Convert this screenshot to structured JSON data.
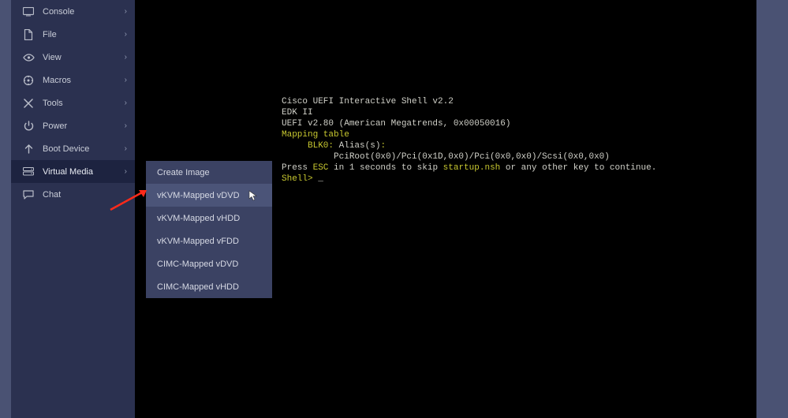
{
  "sidebar": {
    "items": [
      {
        "label": "Console",
        "icon": "console-icon"
      },
      {
        "label": "File",
        "icon": "file-icon"
      },
      {
        "label": "View",
        "icon": "view-icon"
      },
      {
        "label": "Macros",
        "icon": "macros-icon"
      },
      {
        "label": "Tools",
        "icon": "tools-icon"
      },
      {
        "label": "Power",
        "icon": "power-icon"
      },
      {
        "label": "Boot Device",
        "icon": "boot-device-icon"
      },
      {
        "label": "Virtual Media",
        "icon": "virtual-media-icon"
      },
      {
        "label": "Chat",
        "icon": "chat-icon"
      }
    ]
  },
  "submenu": {
    "items": [
      {
        "label": "Create Image"
      },
      {
        "label": "vKVM-Mapped vDVD"
      },
      {
        "label": "vKVM-Mapped vHDD"
      },
      {
        "label": "vKVM-Mapped vFDD"
      },
      {
        "label": "CIMC-Mapped vDVD"
      },
      {
        "label": "CIMC-Mapped vHDD"
      }
    ],
    "hover_index": 1
  },
  "terminal": {
    "line1": "Cisco UEFI Interactive Shell v2.2",
    "line2": "EDK II",
    "line3": "UEFI v2.80 (American Megatrends, 0x00050016)",
    "mapping_header": "Mapping table",
    "blk_line_a": "     BLK0: ",
    "blk_line_b": "Alias(s)",
    "blk_line_c": ":",
    "pci_line": "          PciRoot(0x0)/Pci(0x1D,0x0)/Pci(0x0,0x0)/Scsi(0x0,0x0)",
    "press_a": "Press ",
    "press_esc": "ESC",
    "press_b": " in 1 seconds to skip ",
    "press_nsh": "startup.nsh",
    "press_c": " or any other key to continue.",
    "shell_a": "Shell> ",
    "cursor": "_"
  }
}
